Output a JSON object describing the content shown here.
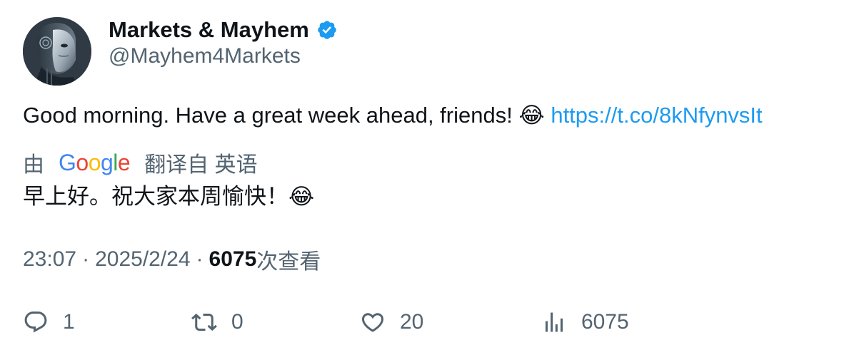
{
  "author": {
    "display_name": "Markets & Mayhem",
    "handle": "@Mayhem4Markets",
    "verified": true
  },
  "tweet": {
    "text": "Good morning. Have a great week ahead, friends! ",
    "emoji": "😂",
    "link": "https://t.co/8kNfynvsIt"
  },
  "translation": {
    "prefix": "由",
    "provider": "Google",
    "suffix": "翻译自 英语",
    "text": "早上好。祝大家本周愉快！",
    "emoji": "😂"
  },
  "meta": {
    "time": "23:07",
    "separator": "·",
    "date": "2025/2/24",
    "views": "6075",
    "views_label": "次查看"
  },
  "actions": {
    "replies": "1",
    "retweets": "0",
    "likes": "20",
    "views": "6075"
  },
  "colors": {
    "text": "#0f1419",
    "secondary": "#536471",
    "link": "#1d9bf0",
    "verified": "#1d9bf0"
  }
}
